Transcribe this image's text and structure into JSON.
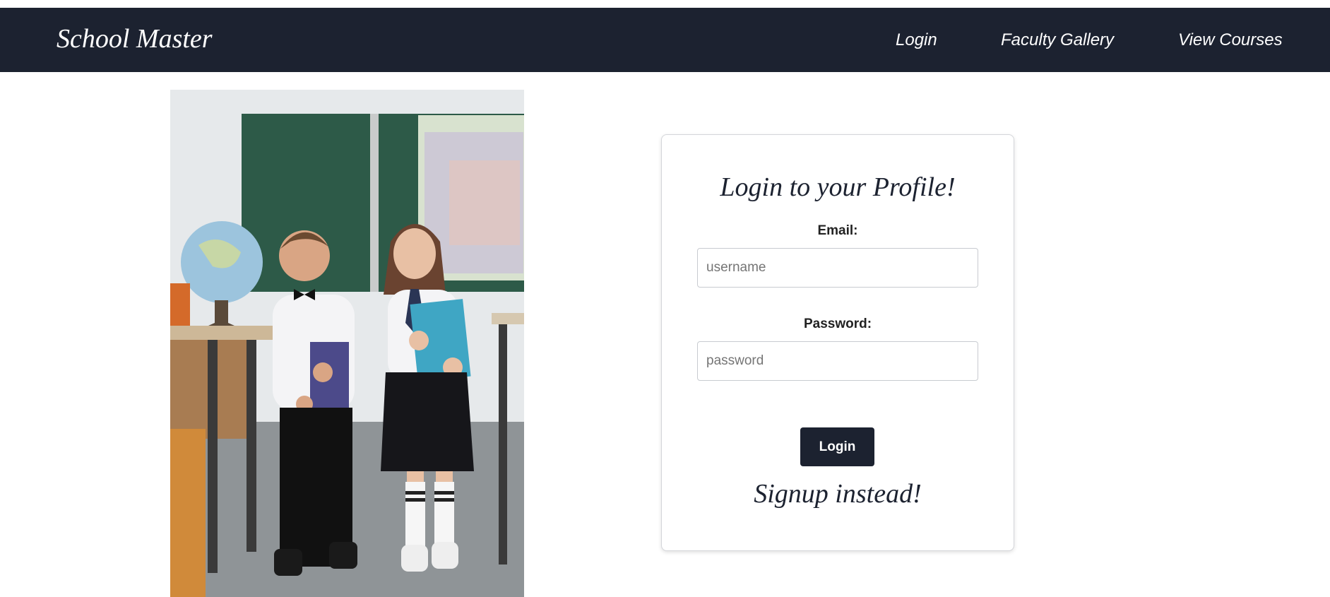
{
  "navbar": {
    "brand": "School Master",
    "links": [
      {
        "label": "Login"
      },
      {
        "label": "Faculty Gallery"
      },
      {
        "label": "View Courses"
      }
    ]
  },
  "login_form": {
    "title": "Login to your Profile!",
    "email_label": "Email:",
    "email_placeholder": "username",
    "email_value": "",
    "password_label": "Password:",
    "password_placeholder": "password",
    "password_value": "",
    "submit_label": "Login",
    "signup_link": "Signup instead!"
  },
  "colors": {
    "navbar_bg": "#1c2230",
    "button_bg": "#1c2230",
    "text_dark": "#1c2230"
  },
  "photo": {
    "subject": "two children in school uniforms standing in a classroom"
  }
}
